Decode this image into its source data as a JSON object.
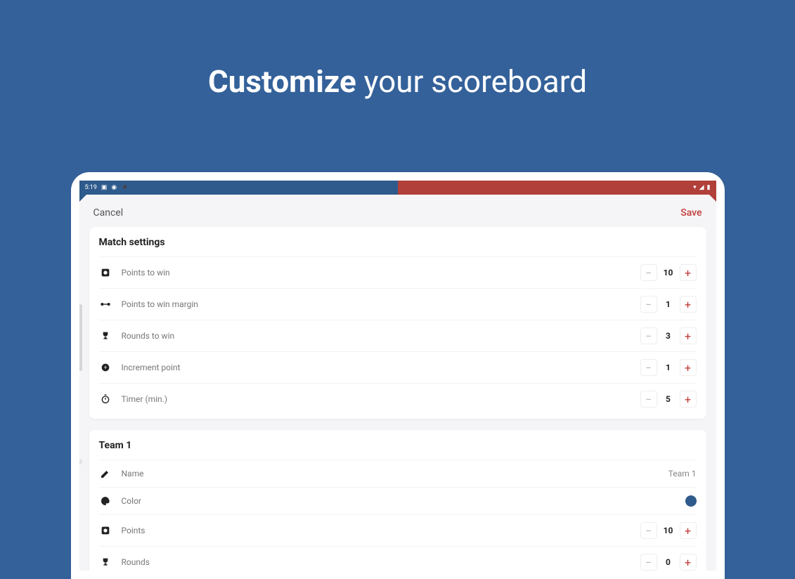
{
  "hero": {
    "bold": "Customize",
    "rest": " your scoreboard"
  },
  "statusbar": {
    "time": "5:19"
  },
  "toolbar": {
    "cancel": "Cancel",
    "save": "Save"
  },
  "match": {
    "title": "Match settings",
    "rows": [
      {
        "label": "Points to win",
        "value": "10"
      },
      {
        "label": "Points to win margin",
        "value": "1"
      },
      {
        "label": "Rounds to win",
        "value": "3"
      },
      {
        "label": "Increment point",
        "value": "1"
      },
      {
        "label": "Timer (min.)",
        "value": "5"
      }
    ]
  },
  "team1": {
    "title": "Team 1",
    "name_label": "Name",
    "name_value": "Team 1",
    "color_label": "Color",
    "color_hex": "#2f5a8c",
    "points_label": "Points",
    "points_value": "10",
    "rounds_label": "Rounds",
    "rounds_value": "0"
  },
  "stepper_glyphs": {
    "minus": "−",
    "plus": "+"
  }
}
